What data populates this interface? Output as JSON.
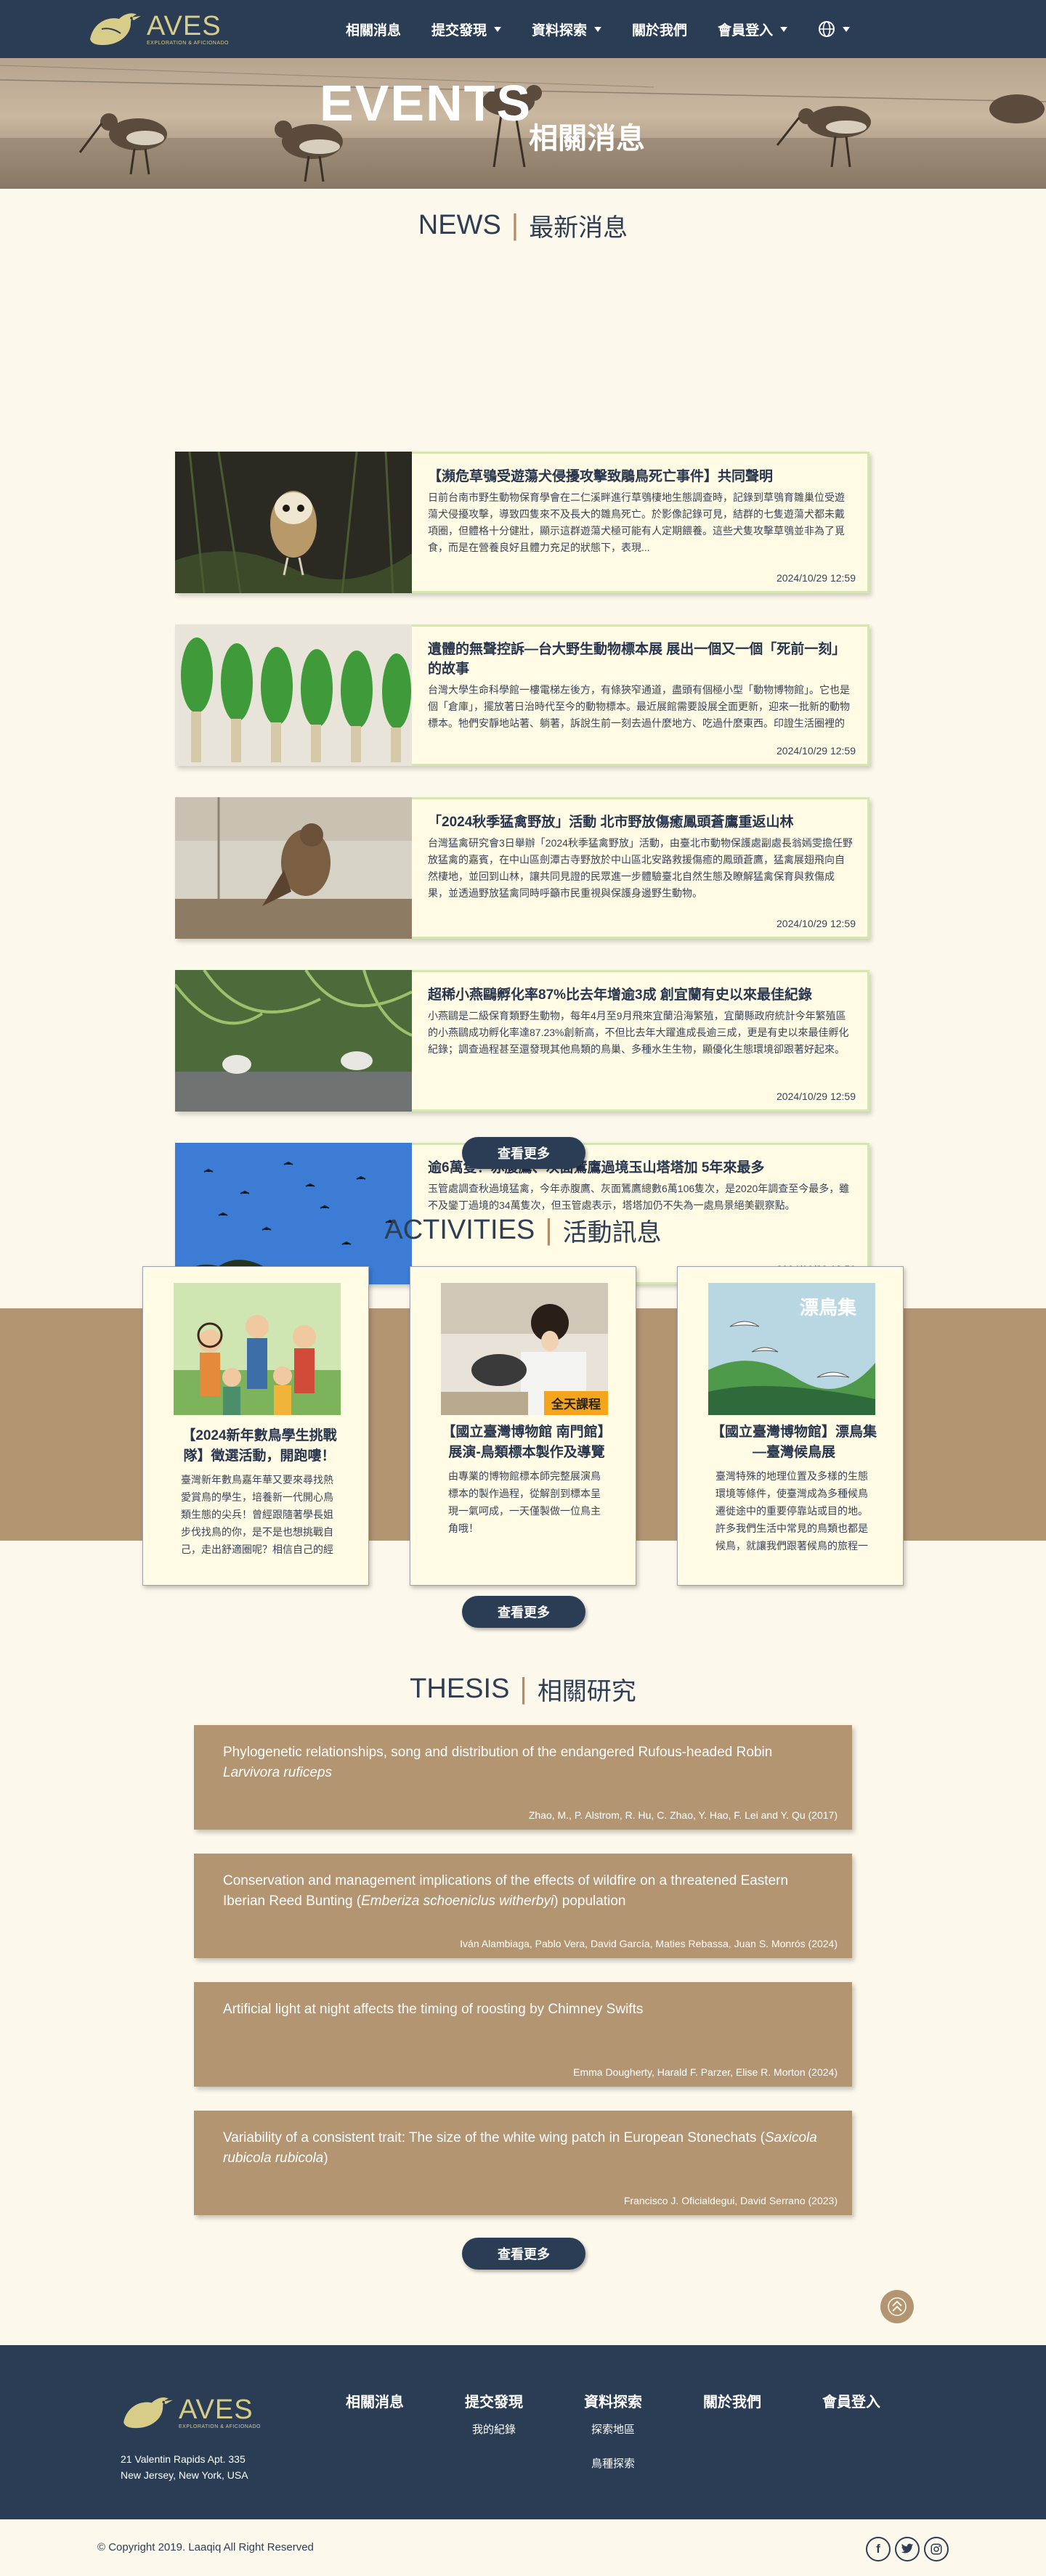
{
  "brand": {
    "name": "AVES",
    "tagline": "EXPLORATION & AFICIONADO"
  },
  "nav": {
    "items": [
      {
        "label": "相關消息",
        "dropdown": false
      },
      {
        "label": "提交發現",
        "dropdown": true
      },
      {
        "label": "資料探索",
        "dropdown": true
      },
      {
        "label": "關於我們",
        "dropdown": false
      },
      {
        "label": "會員登入",
        "dropdown": true
      }
    ],
    "language_icon": "globe-icon"
  },
  "hero": {
    "title": "EVENTS",
    "subtitle": "相關消息"
  },
  "news": {
    "heading_en": "NEWS",
    "heading_zh": "最新消息",
    "items": [
      {
        "title": "【瀕危草鴞受遊蕩犬侵擾攻擊致鵰鳥死亡事件】共同聲明",
        "text": "日前台南市野生動物保育學會在二仁溪畔進行草鴞棲地生態調查時，記錄到草鴞育雛巢位受遊蕩犬侵擾攻擊，導致四隻來不及長大的雛鳥死亡。於影像記錄可見，結群的七隻遊蕩犬都未戴項圈，但體格十分健壯，顯示這群遊蕩犬極可能有人定期餵養。這些犬隻攻擊草鴞並非為了覓食，而是在營養良好且體力充足的狀態下，表現...",
        "date": "2024/10/29 12:59",
        "image": "owl"
      },
      {
        "title": "遺體的無聲控訴—台大野生動物標本展 展出一個又一個「死前一刻」的故事",
        "text": "台灣大學生命科學館一樓電梯左後方，有條狹窄通道，盡頭有個極小型「動物博物館」。它也是個「倉庫」，擺放著日治時代至今的動物標本。最近展館需要設展全面更新，迎來一批新的動物標本。牠們安靜地站著、躺著，訴說生前一刻去過什麼地方、吃過什麼東西。印證生活圈裡的生物多樣性……然後突然死去。死因通常是犬...",
        "date": "2024/10/29 12:59",
        "image": "specimens"
      },
      {
        "title": "「2024秋季猛禽野放」活動 北市野放傷癒鳳頭蒼鷹重返山林",
        "text": "台灣猛禽研究會3日舉辦「2024秋季猛禽野放」活動，由臺北市動物保護處副處長翁嫣雯擔任野放猛禽的嘉賓，在中山區劍潭古寺野放於中山區北安路救援傷癒的鳳頭蒼鷹，猛禽展翅飛向自然棲地，並回到山林，讓共同見證的民眾進一步體驗臺北自然生態及瞭解猛禽保育與救傷成果，並透過野放猛禽同時呼籲市民重視與保護身邊野生動物。",
        "date": "2024/10/29 12:59",
        "image": "hawk"
      },
      {
        "title": "超稀小燕鷗孵化率87%比去年增逾3成 創宜蘭有史以來最佳紀錄",
        "text": "小燕鷗是二級保育類野生動物，每年4月至9月飛來宜蘭沿海繁殖，宜蘭縣政府統計今年繁殖區的小燕鷗成功孵化率達87.23%創新高，不但比去年大躍進成長逾三成，更是有史以來最佳孵化紀錄；調查過程甚至還發現其他鳥類的鳥巢、多種水生生物，顯優化生態環境卻跟著好起來。",
        "date": "2024/10/29 12:59",
        "image": "terns"
      },
      {
        "title": "逾6萬隻！赤腹鷹、灰面鵟鷹過境玉山塔塔加 5年來最多",
        "text": "玉管處調查秋過境猛禽，今年赤腹鷹、灰面鵟鷹總數6萬106隻次，是2020年調查至今最多，雖不及鑾丁過境的34萬隻次，但玉管處表示，塔塔加仍不失為一處鳥景絕美觀察點。",
        "date": "2024/10/29 12:59",
        "image": "sky"
      }
    ],
    "more_label": "查看更多"
  },
  "activities": {
    "heading_en": "ACTIVITIES",
    "heading_zh": "活動訊息",
    "items": [
      {
        "title": "【2024新年數鳥學生挑戰隊】徵選活動，開跑嘍！",
        "text": "臺灣新年數鳥嘉年華又要來尋找熱愛賞鳥的學生，培養新一代開心鳥類生態的尖兵！曾經跟隨著學長姐步伐找鳥的你，是不是也想挑戰自己，走出舒適圈呢？相信自己的經驗，和夥伴們一起...",
        "image": "students"
      },
      {
        "title": "【國立臺灣博物館 南門館】展演-鳥類標本製作及導覽",
        "text": "由專業的博物館標本師完整展演鳥標本的製作過程，從解剖到標本呈現一氣呵成，一天僅製做一位鳥主角哦！",
        "image": "taxidermy",
        "badge": "全天課程"
      },
      {
        "title": "【國立臺灣博物館】漂鳥集—臺灣候鳥展",
        "text": "臺灣特殊的地理位置及多樣的生態環境等條件，使臺灣成為多種候鳥遷徙途中的重要停靠站或目的地。許多我們生活中常見的鳥類也都是候鳥，就讓我們跟著候鳥的旅程一探究竟！...",
        "image": "poster",
        "poster_text": "漂鳥集"
      }
    ],
    "more_label": "查看更多"
  },
  "thesis": {
    "heading_en": "THESIS",
    "heading_zh": "相關研究",
    "items": [
      {
        "title_pre": "Phylogenetic relationships, song and distribution of the endangered Rufous-headed Robin ",
        "title_em": "Larvivora ruficeps",
        "title_post": "",
        "authors": "Zhao, M., P. Alstrom, R. Hu, C. Zhao, Y. Hao, F. Lei and Y. Qu (2017)"
      },
      {
        "title_pre": "Conservation and management implications of the effects of wildfire on a threatened Eastern Iberian Reed Bunting (",
        "title_em": "Emberiza schoeniclus witherbyi",
        "title_post": ") population",
        "authors": "Iván Alambiaga, Pablo Vera, David García, Maties Rebassa, Juan S. Monrós (2024)"
      },
      {
        "title_pre": "Artificial light at night affects the timing of roosting by Chimney Swifts",
        "title_em": "",
        "title_post": "",
        "authors": "Emma Dougherty, Harald F. Parzer, Elise R. Morton (2024)"
      },
      {
        "title_pre": "Variability of a consistent trait: The size of the white wing patch in European Stonechats (",
        "title_em": "Saxicola rubicola rubicola",
        "title_post": ")",
        "authors": "Francisco J. Oficialdegui, David Serrano (2023)"
      }
    ],
    "more_label": "查看更多"
  },
  "footer": {
    "address_line1": "21 Valentin Rapids Apt. 335",
    "address_line2": "New Jersey, New York, USA",
    "columns": [
      {
        "head": "相關消息",
        "links": []
      },
      {
        "head": "提交發現",
        "links": [
          "我的紀錄"
        ]
      },
      {
        "head": "資料探索",
        "links": [
          "探索地區",
          "鳥種探索"
        ]
      },
      {
        "head": "關於我們",
        "links": []
      },
      {
        "head": "會員登入",
        "links": []
      }
    ],
    "copyright": "© Copyright 2019. Laaqiq All Right Reserved",
    "social": [
      "f",
      "t",
      "ig"
    ]
  },
  "colors": {
    "navy": "#2b3d55",
    "tan": "#b49572",
    "cream": "#fcf8ec",
    "gold": "#d8cd88"
  }
}
